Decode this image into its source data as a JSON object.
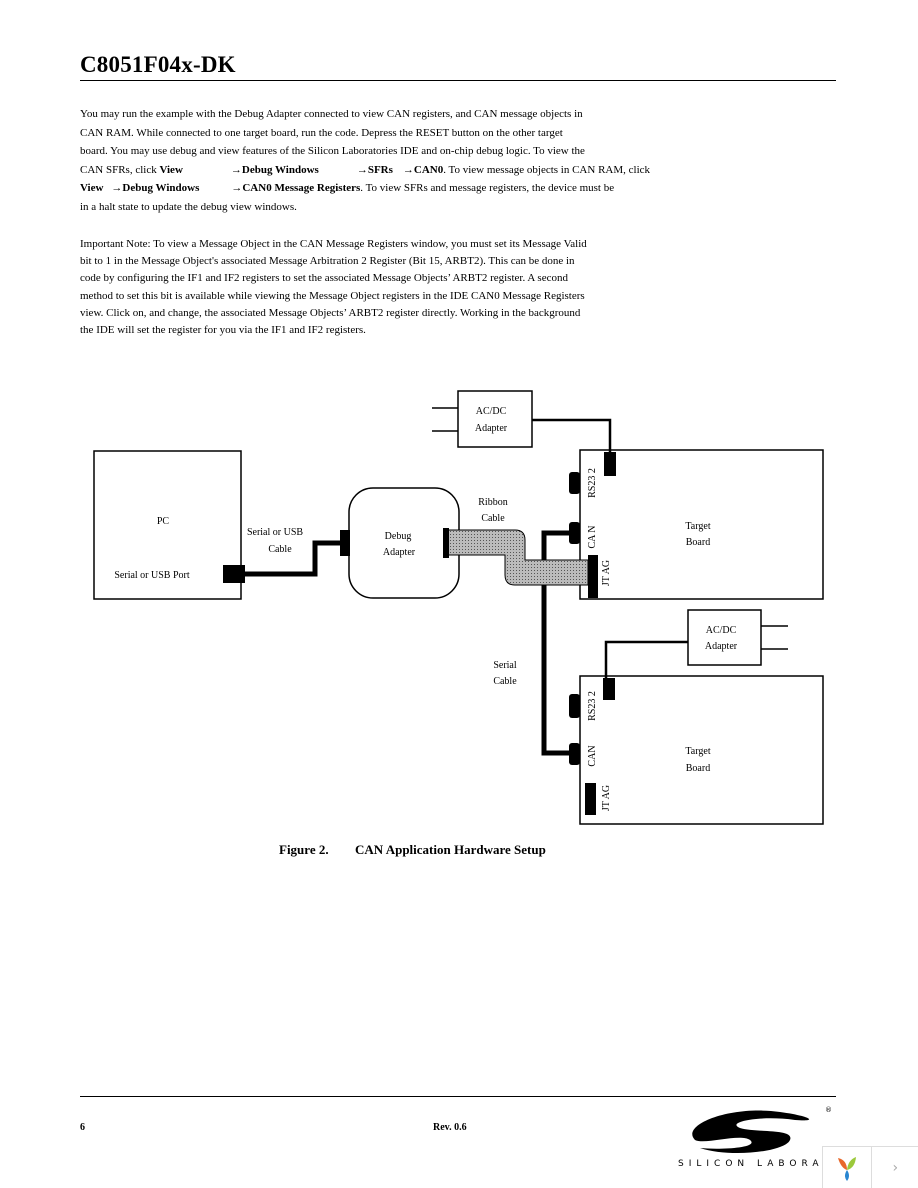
{
  "header": {
    "title": "C8051F04x-DK"
  },
  "paragraph1": {
    "line1": "You may run the example with the Debug Adapter connected to view CAN registers, and CAN message objects in",
    "line2": "CAN RAM. While connected to one target board, run the code. Depress the RESET button on the other target",
    "line3": "board. You may use debug and view features of the Silicon Laboratories IDE and on-chip debug logic. To view the",
    "line4_a": "CAN SFRs, click ",
    "line4_view": "View",
    "line4_dw": "→Debug Windows",
    "line4_sfrs": "→SFRs",
    "line4_can0": "→CAN0",
    "line4_b": ". To view message objects in CAN RAM, click",
    "line5_view": "View",
    "line5_dw": "→Debug Windows",
    "line5_mr": "→CAN0 Message Registers",
    "line5_b": ". To view SFRs and message registers, the device must be",
    "line6": "in a halt state to update the debug view windows."
  },
  "paragraph2": {
    "lines": [
      "Important Note: To view a Message Object in the CAN Message Registers window, you must set its Message Valid",
      "bit to 1 in the Message Object's associated Message Arbitration 2 Register (Bit 15, ARBT2). This can be done in",
      "code by configuring the IF1 and IF2 registers to set the associated Message Objects’ ARBT2 register. A second",
      "method to set this bit is available while viewing the Message Object registers in the IDE CAN0 Message Registers",
      "view. Click on, and change, the associated Message Objects’ ARBT2 register directly. Working in the background",
      "the IDE will set the register for you via the IF1 and IF2 registers."
    ]
  },
  "figure": {
    "acdc1": [
      "AC/DC",
      "Adapter"
    ],
    "acdc2": [
      "AC/DC",
      "Adapter"
    ],
    "pc": "PC",
    "pc_port": "Serial or USB Port",
    "usb_cable": [
      "Serial or USB",
      "Cable"
    ],
    "debug_adapter": [
      "Debug",
      "Adapter"
    ],
    "ribbon_cable": [
      "Ribbon",
      "Cable"
    ],
    "serial_cable": [
      "Serial",
      "Cable"
    ],
    "target1": [
      "Target",
      "Board"
    ],
    "target2": [
      "Target",
      "Board"
    ],
    "rs232": "RS23 2",
    "can1": "CA N",
    "can2": "CAN",
    "jtag": "JT AG",
    "caption_num": "Figure 2.",
    "caption": "CAN Application Hardware Setup"
  },
  "footer": {
    "page": "6",
    "rev": "Rev. 0.6",
    "logo_text": "SILICON LABORATORIES"
  },
  "viewer": {
    "next_icon": "chevron-right-icon",
    "app_icon": "app-logo-icon"
  }
}
